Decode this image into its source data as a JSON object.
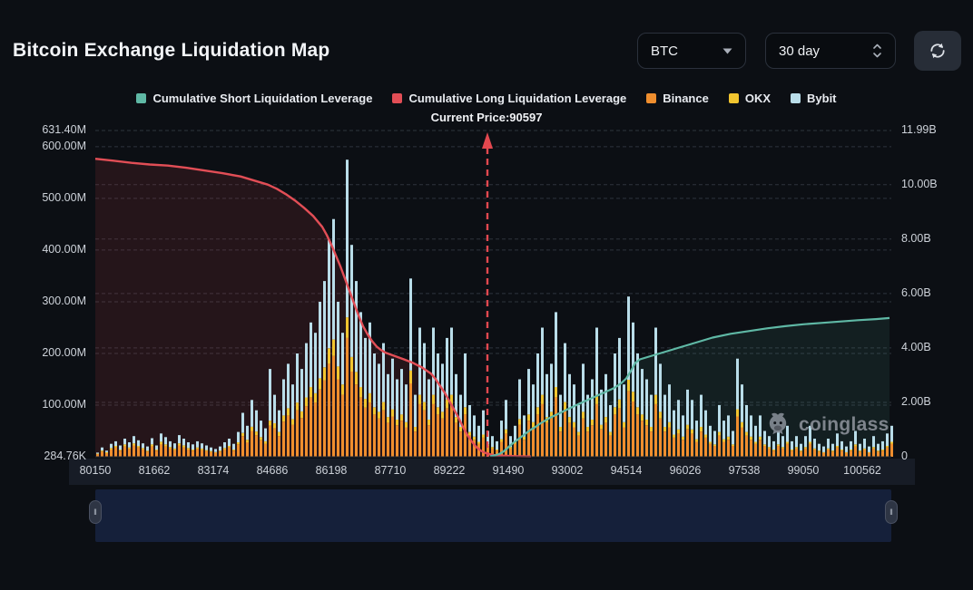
{
  "header": {
    "title": "Bitcoin Exchange Liquidation Map",
    "coin_select": {
      "value": "BTC"
    },
    "timeframe_select": {
      "value": "30 day"
    }
  },
  "watermark": {
    "text": "coinglass"
  },
  "colors": {
    "short_teal": "#5fb8a5",
    "long_red": "#e24e56",
    "binance_orange": "#ef8e2e",
    "okx_yellow": "#f2c52f",
    "bybit_blue": "#b9dde9",
    "slider_bg": "#15203a"
  },
  "chart_data": {
    "type": "mixed-bar-line",
    "title": "Bitcoin Exchange Liquidation Map",
    "current_price": 90597,
    "current_price_label": "Current Price:90597",
    "current_price_line_index": 86.4,
    "grid": "dashed",
    "legend_position": "top-center",
    "left_axis": {
      "unit": "M",
      "max_value_m": 631.4,
      "ticks": [
        {
          "label": "631.40M",
          "value": 631.4
        },
        {
          "label": "600.00M",
          "value": 600
        },
        {
          "label": "500.00M",
          "value": 500
        },
        {
          "label": "400.00M",
          "value": 400
        },
        {
          "label": "300.00M",
          "value": 300
        },
        {
          "label": "200.00M",
          "value": 200
        },
        {
          "label": "100.00M",
          "value": 100
        },
        {
          "label": "284.76K",
          "value": 0.28476
        }
      ]
    },
    "right_axis": {
      "unit": "B",
      "max_value_b": 11.99,
      "ticks": [
        {
          "label": "11.99B",
          "value": 11.99
        },
        {
          "label": "10.00B",
          "value": 10
        },
        {
          "label": "8.00B",
          "value": 8
        },
        {
          "label": "6.00B",
          "value": 6
        },
        {
          "label": "4.00B",
          "value": 4
        },
        {
          "label": "2.00B",
          "value": 2
        },
        {
          "label": "0",
          "value": 0
        }
      ]
    },
    "x_ticks": [
      "80150",
      "81662",
      "83174",
      "84686",
      "86198",
      "87710",
      "89222",
      "91490",
      "93002",
      "94514",
      "96026",
      "97538",
      "99050",
      "100562"
    ],
    "series": [
      {
        "name": "Cumulative Short Liquidation Leverage",
        "type": "line",
        "axis": "right",
        "color": "#5fb8a5",
        "points": [
          [
            87,
            0.02
          ],
          [
            88,
            0.05
          ],
          [
            89,
            0.1
          ],
          [
            90,
            0.2
          ],
          [
            91,
            0.35
          ],
          [
            92,
            0.5
          ],
          [
            93,
            0.62
          ],
          [
            94,
            0.75
          ],
          [
            95,
            0.88
          ],
          [
            96,
            1.0
          ],
          [
            97,
            1.1
          ],
          [
            98,
            1.22
          ],
          [
            100,
            1.42
          ],
          [
            102,
            1.58
          ],
          [
            104,
            1.74
          ],
          [
            106,
            1.9
          ],
          [
            108,
            2.05
          ],
          [
            110,
            2.2
          ],
          [
            112,
            2.35
          ],
          [
            114,
            2.5
          ],
          [
            115,
            2.6
          ],
          [
            116,
            2.72
          ],
          [
            117,
            2.88
          ],
          [
            118,
            3.15
          ],
          [
            119,
            3.45
          ],
          [
            120,
            3.58
          ],
          [
            122,
            3.68
          ],
          [
            124,
            3.78
          ],
          [
            126,
            3.88
          ],
          [
            128,
            3.98
          ],
          [
            130,
            4.08
          ],
          [
            132,
            4.18
          ],
          [
            134,
            4.28
          ],
          [
            136,
            4.38
          ],
          [
            140,
            4.52
          ],
          [
            144,
            4.62
          ],
          [
            148,
            4.72
          ],
          [
            152,
            4.8
          ],
          [
            156,
            4.87
          ],
          [
            160,
            4.92
          ],
          [
            164,
            4.97
          ],
          [
            168,
            5.02
          ],
          [
            172,
            5.06
          ],
          [
            175,
            5.1
          ]
        ]
      },
      {
        "name": "Cumulative Long Liquidation Leverage",
        "type": "line",
        "axis": "right",
        "color": "#e24e56",
        "points": [
          [
            0,
            10.95
          ],
          [
            4,
            10.88
          ],
          [
            8,
            10.8
          ],
          [
            12,
            10.74
          ],
          [
            16,
            10.7
          ],
          [
            20,
            10.62
          ],
          [
            24,
            10.52
          ],
          [
            28,
            10.42
          ],
          [
            32,
            10.3
          ],
          [
            35,
            10.15
          ],
          [
            38,
            10.0
          ],
          [
            40,
            9.85
          ],
          [
            42,
            9.65
          ],
          [
            44,
            9.42
          ],
          [
            46,
            9.15
          ],
          [
            48,
            8.85
          ],
          [
            50,
            8.45
          ],
          [
            51,
            8.15
          ],
          [
            52,
            7.8
          ],
          [
            53,
            7.4
          ],
          [
            54,
            7.0
          ],
          [
            55,
            6.55
          ],
          [
            56,
            6.1
          ],
          [
            57,
            5.65
          ],
          [
            58,
            5.2
          ],
          [
            59,
            4.8
          ],
          [
            60,
            4.5
          ],
          [
            61,
            4.25
          ],
          [
            62,
            4.05
          ],
          [
            63,
            3.92
          ],
          [
            64,
            3.82
          ],
          [
            66,
            3.7
          ],
          [
            68,
            3.58
          ],
          [
            70,
            3.45
          ],
          [
            72,
            3.28
          ],
          [
            74,
            3.05
          ],
          [
            75,
            2.85
          ],
          [
            76,
            2.6
          ],
          [
            77,
            2.35
          ],
          [
            78,
            2.05
          ],
          [
            79,
            1.75
          ],
          [
            80,
            1.45
          ],
          [
            81,
            1.1
          ],
          [
            82,
            0.8
          ],
          [
            83,
            0.55
          ],
          [
            84,
            0.35
          ],
          [
            85,
            0.22
          ],
          [
            86,
            0.14
          ],
          [
            87,
            0.09
          ],
          [
            88,
            0.06
          ],
          [
            90,
            0.04
          ],
          [
            93,
            0.02
          ],
          [
            96,
            0.01
          ]
        ]
      },
      {
        "name": "Binance",
        "type": "bar",
        "axis": "left",
        "color": "#ef8e2e"
      },
      {
        "name": "OKX",
        "type": "bar",
        "axis": "left",
        "color": "#f2c52f"
      },
      {
        "name": "Bybit",
        "type": "bar",
        "axis": "left",
        "color": "#b9dde9"
      }
    ],
    "bars_stacked_millions": [
      [
        5,
        1,
        2
      ],
      [
        10,
        2,
        6
      ],
      [
        7,
        2,
        3
      ],
      [
        14,
        3,
        8
      ],
      [
        18,
        3,
        9
      ],
      [
        12,
        2,
        8
      ],
      [
        20,
        4,
        11
      ],
      [
        15,
        3,
        10
      ],
      [
        22,
        4,
        14
      ],
      [
        18,
        3,
        11
      ],
      [
        14,
        3,
        9
      ],
      [
        10,
        2,
        8
      ],
      [
        20,
        4,
        12
      ],
      [
        12,
        2,
        8
      ],
      [
        24,
        5,
        16
      ],
      [
        20,
        4,
        14
      ],
      [
        16,
        3,
        11
      ],
      [
        13,
        3,
        10
      ],
      [
        22,
        4,
        16
      ],
      [
        18,
        4,
        13
      ],
      [
        14,
        3,
        11
      ],
      [
        12,
        2,
        10
      ],
      [
        15,
        3,
        12
      ],
      [
        13,
        3,
        10
      ],
      [
        11,
        2,
        9
      ],
      [
        9,
        2,
        7
      ],
      [
        8,
        1,
        6
      ],
      [
        10,
        2,
        8
      ],
      [
        14,
        3,
        11
      ],
      [
        18,
        3,
        14
      ],
      [
        12,
        2,
        11
      ],
      [
        24,
        4,
        20
      ],
      [
        40,
        6,
        39
      ],
      [
        28,
        5,
        27
      ],
      [
        50,
        8,
        52
      ],
      [
        42,
        7,
        41
      ],
      [
        32,
        6,
        32
      ],
      [
        25,
        5,
        25
      ],
      [
        60,
        10,
        100
      ],
      [
        55,
        10,
        55
      ],
      [
        40,
        8,
        42
      ],
      [
        68,
        12,
        70
      ],
      [
        80,
        14,
        86
      ],
      [
        62,
        11,
        67
      ],
      [
        90,
        15,
        95
      ],
      [
        75,
        13,
        82
      ],
      [
        98,
        17,
        105
      ],
      [
        115,
        20,
        125
      ],
      [
        105,
        18,
        117
      ],
      [
        130,
        22,
        148
      ],
      [
        148,
        25,
        167
      ],
      [
        180,
        30,
        210
      ],
      [
        195,
        32,
        233
      ],
      [
        150,
        25,
        125
      ],
      [
        120,
        20,
        100
      ],
      [
        230,
        40,
        305
      ],
      [
        165,
        28,
        217
      ],
      [
        140,
        24,
        176
      ],
      [
        115,
        20,
        145
      ],
      [
        95,
        17,
        118
      ],
      [
        105,
        18,
        137
      ],
      [
        82,
        14,
        104
      ],
      [
        74,
        13,
        93
      ],
      [
        90,
        16,
        114
      ],
      [
        66,
        11,
        83
      ],
      [
        78,
        14,
        98
      ],
      [
        61,
        11,
        78
      ],
      [
        70,
        12,
        88
      ],
      [
        57,
        10,
        73
      ],
      [
        142,
        25,
        178
      ],
      [
        49,
        9,
        62
      ],
      [
        102,
        18,
        130
      ],
      [
        90,
        16,
        114
      ],
      [
        61,
        11,
        78
      ],
      [
        102,
        18,
        130
      ],
      [
        82,
        14,
        104
      ],
      [
        74,
        13,
        93
      ],
      [
        94,
        17,
        119
      ],
      [
        102,
        18,
        130
      ],
      [
        66,
        11,
        83
      ],
      [
        49,
        9,
        62
      ],
      [
        82,
        14,
        104
      ],
      [
        41,
        7,
        52
      ],
      [
        33,
        6,
        41
      ],
      [
        25,
        4,
        31
      ],
      [
        37,
        6,
        47
      ],
      [
        21,
        3,
        26
      ],
      [
        16,
        3,
        21
      ],
      [
        12,
        2,
        16
      ],
      [
        29,
        5,
        36
      ],
      [
        45,
        8,
        57
      ],
      [
        16,
        3,
        21
      ],
      [
        25,
        4,
        31
      ],
      [
        62,
        11,
        77
      ],
      [
        33,
        6,
        41
      ],
      [
        70,
        12,
        88
      ],
      [
        57,
        10,
        73
      ],
      [
        82,
        14,
        104
      ],
      [
        102,
        18,
        130
      ],
      [
        66,
        11,
        83
      ],
      [
        74,
        13,
        93
      ],
      [
        115,
        20,
        145
      ],
      [
        49,
        9,
        62
      ],
      [
        90,
        16,
        114
      ],
      [
        66,
        11,
        83
      ],
      [
        57,
        10,
        73
      ],
      [
        41,
        7,
        52
      ],
      [
        74,
        13,
        93
      ],
      [
        49,
        9,
        62
      ],
      [
        61,
        11,
        78
      ],
      [
        102,
        18,
        130
      ],
      [
        53,
        9,
        68
      ],
      [
        66,
        11,
        83
      ],
      [
        41,
        7,
        52
      ],
      [
        82,
        14,
        104
      ],
      [
        94,
        17,
        119
      ],
      [
        57,
        10,
        73
      ],
      [
        127,
        22,
        161
      ],
      [
        107,
        19,
        134
      ],
      [
        82,
        14,
        104
      ],
      [
        70,
        12,
        88
      ],
      [
        61,
        11,
        78
      ],
      [
        49,
        9,
        62
      ],
      [
        102,
        18,
        130
      ],
      [
        74,
        13,
        93
      ],
      [
        49,
        9,
        62
      ],
      [
        57,
        10,
        73
      ],
      [
        37,
        6,
        47
      ],
      [
        45,
        8,
        57
      ],
      [
        33,
        6,
        41
      ],
      [
        53,
        9,
        68
      ],
      [
        45,
        8,
        57
      ],
      [
        29,
        5,
        36
      ],
      [
        49,
        9,
        62
      ],
      [
        37,
        6,
        47
      ],
      [
        25,
        4,
        31
      ],
      [
        21,
        3,
        26
      ],
      [
        41,
        7,
        52
      ],
      [
        29,
        5,
        36
      ],
      [
        33,
        6,
        41
      ],
      [
        21,
        3,
        26
      ],
      [
        78,
        14,
        98
      ],
      [
        57,
        10,
        73
      ],
      [
        41,
        7,
        52
      ],
      [
        33,
        6,
        41
      ],
      [
        25,
        4,
        31
      ],
      [
        33,
        6,
        41
      ],
      [
        21,
        3,
        26
      ],
      [
        16,
        3,
        21
      ],
      [
        12,
        2,
        16
      ],
      [
        21,
        3,
        26
      ],
      [
        16,
        3,
        21
      ],
      [
        25,
        4,
        31
      ],
      [
        12,
        2,
        16
      ],
      [
        16,
        3,
        21
      ],
      [
        10,
        2,
        13
      ],
      [
        16,
        3,
        21
      ],
      [
        25,
        4,
        31
      ],
      [
        14,
        2,
        19
      ],
      [
        10,
        2,
        13
      ],
      [
        8,
        1,
        11
      ],
      [
        14,
        2,
        19
      ],
      [
        10,
        2,
        13
      ],
      [
        18,
        3,
        24
      ],
      [
        12,
        2,
        16
      ],
      [
        8,
        1,
        11
      ],
      [
        12,
        2,
        16
      ],
      [
        20,
        4,
        26
      ],
      [
        10,
        2,
        13
      ],
      [
        14,
        2,
        19
      ],
      [
        8,
        1,
        11
      ],
      [
        16,
        3,
        21
      ],
      [
        10,
        2,
        13
      ],
      [
        12,
        2,
        16
      ],
      [
        18,
        3,
        24
      ],
      [
        25,
        4,
        31
      ]
    ]
  }
}
